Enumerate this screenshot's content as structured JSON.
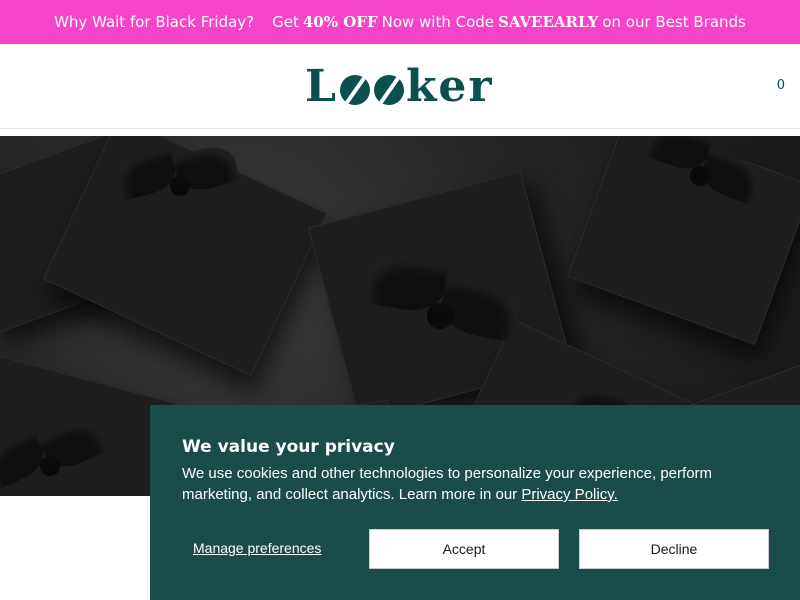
{
  "promo": {
    "part1": "Why Wait for Black Friday?",
    "part2": "Get",
    "discount": "40% OFF",
    "part3": "Now with Code",
    "code": "SAVEEARLY",
    "part4": "on our Best Brands",
    "background_color": "#f544c7"
  },
  "header": {
    "logo_text_start": "L",
    "logo_text_end": "ker",
    "cart_count": "0",
    "brand_color": "#0c4f4f"
  },
  "hero": {
    "image_description_icon": "black-gift-boxes-image"
  },
  "consent": {
    "title": "We value your privacy",
    "description": "We use cookies and other technologies to personalize your experience, perform marketing, and collect analytics. Learn more in our",
    "policy_link": "Privacy Policy.",
    "manage_label": "Manage preferences",
    "accept_label": "Accept",
    "decline_label": "Decline",
    "background_color": "#1a4d4a"
  }
}
